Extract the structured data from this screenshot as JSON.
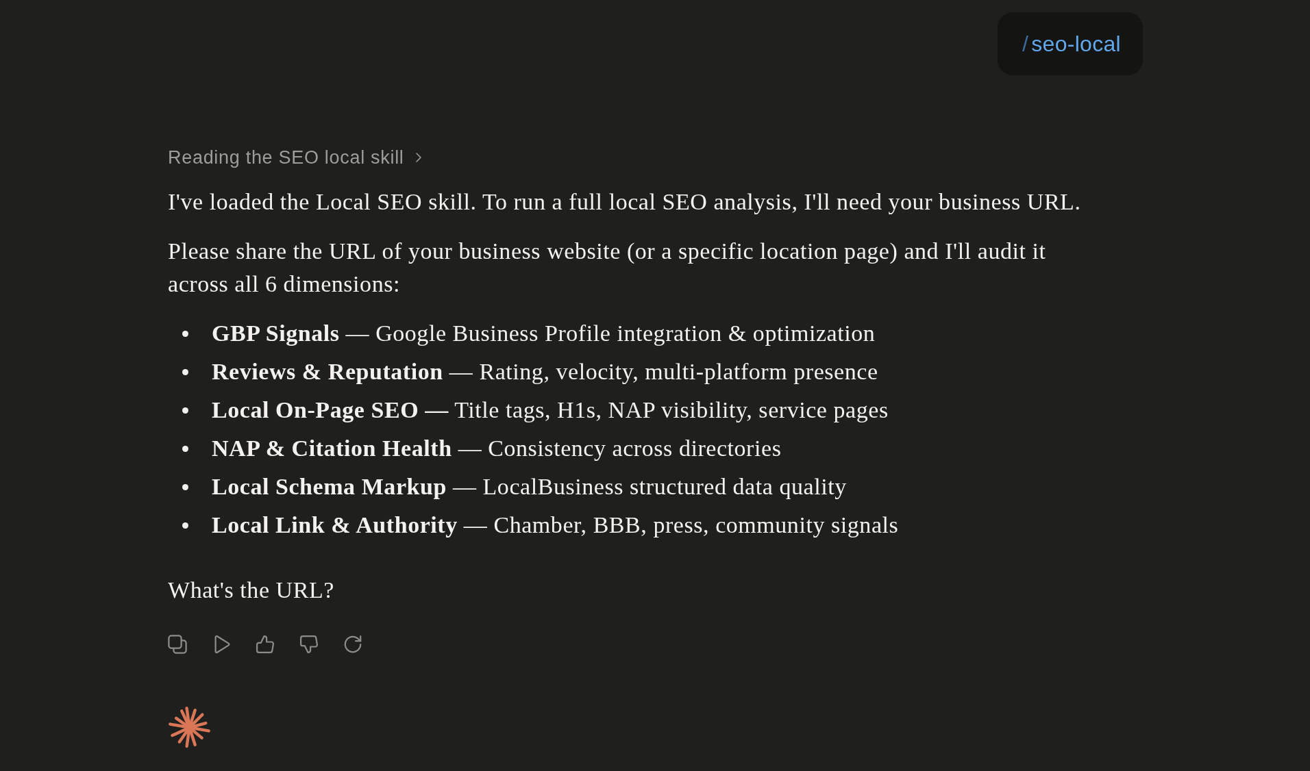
{
  "user_message": {
    "prefix": "/",
    "command": "seo-local"
  },
  "response": {
    "status": "Reading the SEO local skill",
    "paragraphs": [
      "I've loaded the Local SEO skill. To run a full local SEO analysis, I'll need your business URL.",
      "Please share the URL of your business website (or a specific location page) and I'll audit it across all 6 dimensions:"
    ],
    "bullets": [
      "**GBP Signals** — Google Business Profile integration & optimization",
      "**Reviews & Reputation** — Rating, velocity, multi-platform presence",
      "**Local On-Page SEO —** Title tags, H1s, NAP visibility, service pages",
      "**NAP & Citation Health** — Consistency across directories",
      "**Local Schema Markup** — LocalBusiness structured data quality",
      "**Local Link & Authority** — Chamber, BBB, press, community signals"
    ],
    "closing": "What's the URL?"
  }
}
